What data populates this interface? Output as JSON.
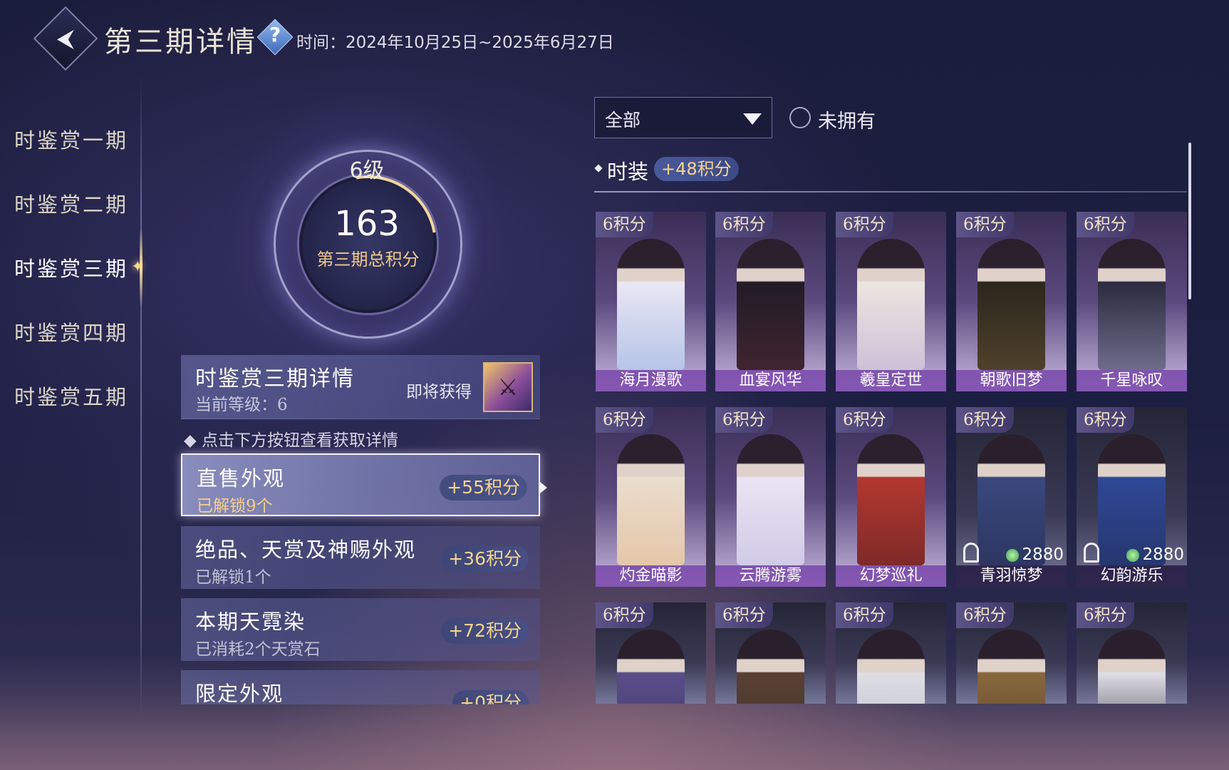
{
  "header": {
    "title": "第三期详情",
    "help_icon": "question-icon",
    "time": "时间：2024年10月25日~2025年6月27日"
  },
  "nav": {
    "items": [
      {
        "label": "时鉴赏一期",
        "active": false
      },
      {
        "label": "时鉴赏二期",
        "active": false
      },
      {
        "label": "时鉴赏三期",
        "active": true
      },
      {
        "label": "时鉴赏四期",
        "active": false
      },
      {
        "label": "时鉴赏五期",
        "active": false
      }
    ]
  },
  "score": {
    "level": "6级",
    "total": "163",
    "label": "第三期总积分"
  },
  "detail": {
    "title": "时鉴赏三期详情",
    "current_level": "当前等级：6",
    "upcoming": "即将获得",
    "hint": "点击下方按钮查看获取详情"
  },
  "categories": [
    {
      "title": "直售外观",
      "sub": "已解锁9个",
      "points": "+55积分",
      "active": true
    },
    {
      "title": "绝品、天赏及神赐外观",
      "sub": "已解锁1个",
      "points": "+36积分",
      "active": false
    },
    {
      "title": "本期天霓染",
      "sub": "已消耗2个天赏石",
      "points": "+72积分",
      "active": false
    },
    {
      "title": "限定外观",
      "sub": "",
      "points": "+0积分",
      "active": false
    }
  ],
  "filter": {
    "dropdown": "全部",
    "checkbox_label": "未拥有"
  },
  "section": {
    "title": "时装",
    "points": "+48积分"
  },
  "cards": [
    {
      "points": "6积分",
      "name": "海月漫歌"
    },
    {
      "points": "6积分",
      "name": "血宴风华"
    },
    {
      "points": "6积分",
      "name": "羲皇定世"
    },
    {
      "points": "6积分",
      "name": "朝歌旧梦"
    },
    {
      "points": "6积分",
      "name": "千星咏叹"
    },
    {
      "points": "6积分",
      "name": "灼金喵影"
    },
    {
      "points": "6积分",
      "name": "云腾游雾"
    },
    {
      "points": "6积分",
      "name": "幻梦巡礼"
    },
    {
      "points": "6积分",
      "name": "青羽惊梦",
      "price": "2880"
    },
    {
      "points": "6积分",
      "name": "幻韵游乐",
      "price": "2880"
    },
    {
      "points": "6积分",
      "name": ""
    },
    {
      "points": "6积分",
      "name": ""
    },
    {
      "points": "6积分",
      "name": ""
    },
    {
      "points": "6积分",
      "name": ""
    },
    {
      "points": "6积分",
      "name": ""
    }
  ]
}
